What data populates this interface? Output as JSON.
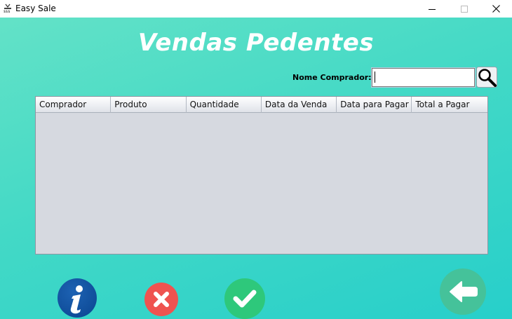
{
  "window": {
    "title": "Easy Sale"
  },
  "page": {
    "title": "Vendas Pedentes"
  },
  "search": {
    "label": "Nome Comprador:",
    "value": ""
  },
  "table": {
    "columns": [
      "Comprador",
      "Produto",
      "Quantidade",
      "Data da Venda",
      "Data para Pagar",
      "Total a Pagar"
    ],
    "rows": []
  },
  "actions": {
    "info_icon": "info-icon",
    "cancel_icon": "close-icon",
    "confirm_icon": "check-icon",
    "back_icon": "arrow-left-icon"
  },
  "colors": {
    "background_top": "#63e2c7",
    "background_bottom": "#27cfca",
    "info": "#0a4590",
    "cancel": "#ef5350",
    "confirm": "#2ec87b",
    "back": "#45c29a"
  }
}
